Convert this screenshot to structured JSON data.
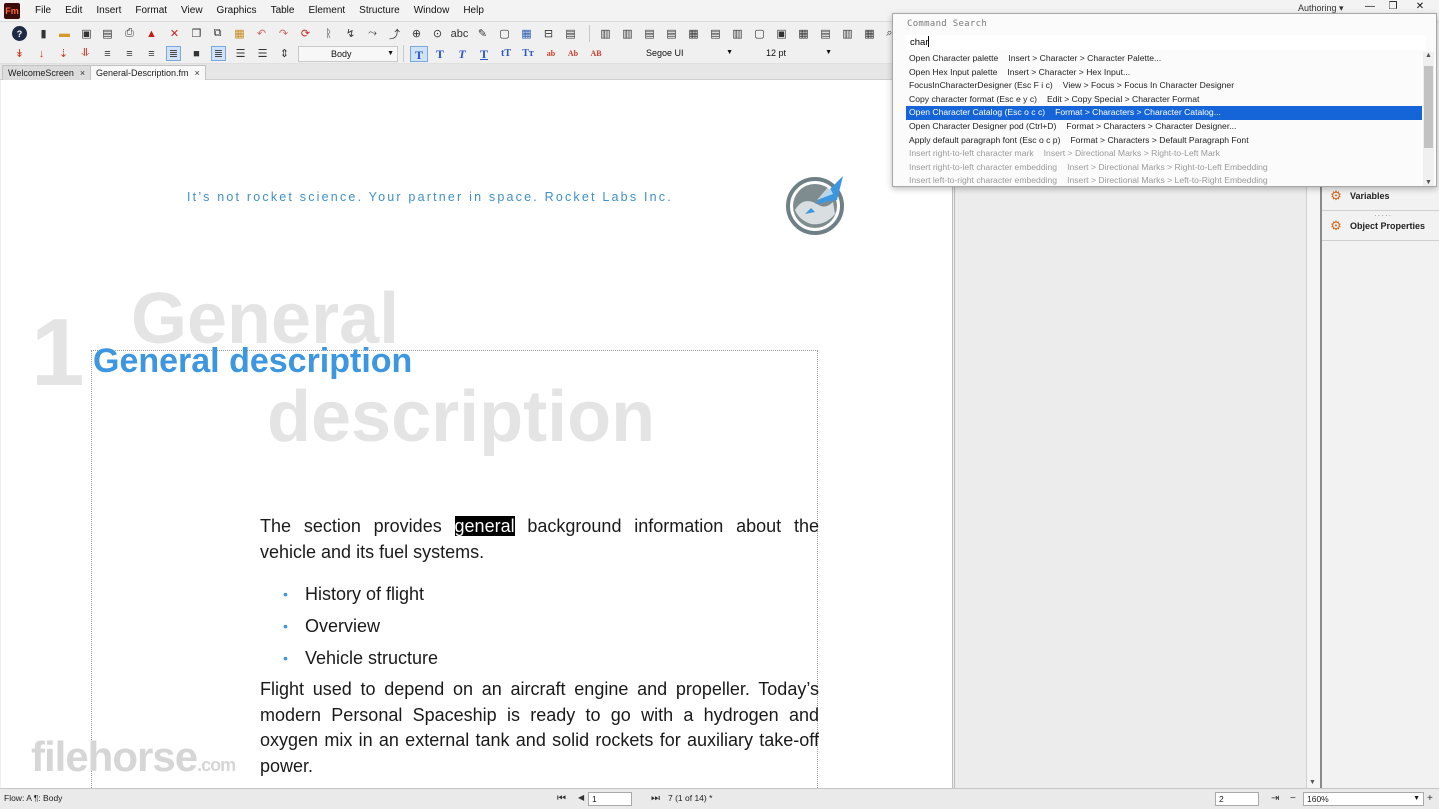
{
  "app": {
    "icon_label": "Fm"
  },
  "menu": [
    "File",
    "Edit",
    "Insert",
    "Format",
    "View",
    "Graphics",
    "Table",
    "Element",
    "Structure",
    "Window",
    "Help"
  ],
  "window": {
    "workspace": "Authoring",
    "minimize": "—",
    "restore": "❐",
    "close": "✕"
  },
  "toolbar": {
    "paragraph_tag": "Body",
    "font": "Segoe UI",
    "font_size": "12 pt",
    "format_toggles": [
      "T",
      "T",
      "T",
      "T",
      "tT",
      "Tт",
      "ab",
      "Ab",
      "AB"
    ]
  },
  "doc_tabs": [
    {
      "label": "WelcomeScreen",
      "close": "×"
    },
    {
      "label": "General-Description.fm",
      "close": "×"
    }
  ],
  "document": {
    "tagline": "It’s not rocket science. Your partner in space. Rocket Labs Inc.",
    "chapter_number": "1",
    "chapter_ghost_line1": "General",
    "chapter_ghost_line2": "description",
    "heading": "General description",
    "para1_before": "The section provides ",
    "para1_highlight": "general",
    "para1_after": " background information about the vehicle and its fuel systems.",
    "bullets": [
      "History of flight",
      "Overview",
      "Vehicle structure"
    ],
    "para2": "Flight used to depend on an aircraft engine and propeller. Today’s modern Personal Spaceship is ready to go with a hydrogen and oxygen mix in an external tank and solid rockets for auxiliary take-off power.",
    "watermark": "filehorse",
    "watermark_suffix": ".com"
  },
  "pods": {
    "variables": "Variables",
    "object_properties": "Object Properties"
  },
  "command_search": {
    "title": "Command Search",
    "query": "char",
    "results": [
      {
        "name": "Open Character palette",
        "path": "Insert > Character > Character Palette...",
        "state": "normal"
      },
      {
        "name": "Open Hex Input palette",
        "path": "Insert > Character > Hex Input...",
        "state": "normal"
      },
      {
        "name": "FocusInCharacterDesigner (Esc F i c)",
        "path": "View > Focus > Focus In Character Designer",
        "state": "normal"
      },
      {
        "name": "Copy character format  (Esc e y c)",
        "path": "Edit > Copy Special > Character Format",
        "state": "normal"
      },
      {
        "name": "Open Character Catalog  (Esc o c c)",
        "path": "Format > Characters > Character Catalog...",
        "state": "selected"
      },
      {
        "name": "Open Character Designer pod  (Ctrl+D)",
        "path": "Format > Characters > Character Designer...",
        "state": "normal"
      },
      {
        "name": "Apply default paragraph font  (Esc o c p)",
        "path": "Format > Characters > Default Paragraph Font",
        "state": "normal"
      },
      {
        "name": "Insert right-to-left character mark",
        "path": "Insert > Directional Marks > Right-to-Left Mark",
        "state": "dim"
      },
      {
        "name": "Insert right-to-left character embedding",
        "path": "Insert > Directional Marks > Right-to-Left Embedding",
        "state": "dim"
      },
      {
        "name": "Insert left-to-right character embedding",
        "path": "Insert > Directional Marks > Left-to-Right Embedding",
        "state": "dim"
      }
    ]
  },
  "status": {
    "flow": "Flow: A  ¶: Body",
    "page_input": "1",
    "page_info": "7 (1 of 14) *",
    "zoom_step": "2",
    "zoom": "160%"
  },
  "colors": {
    "accent": "#3d96e0",
    "selection": "#1565d8",
    "tagline": "#3f90c8"
  }
}
